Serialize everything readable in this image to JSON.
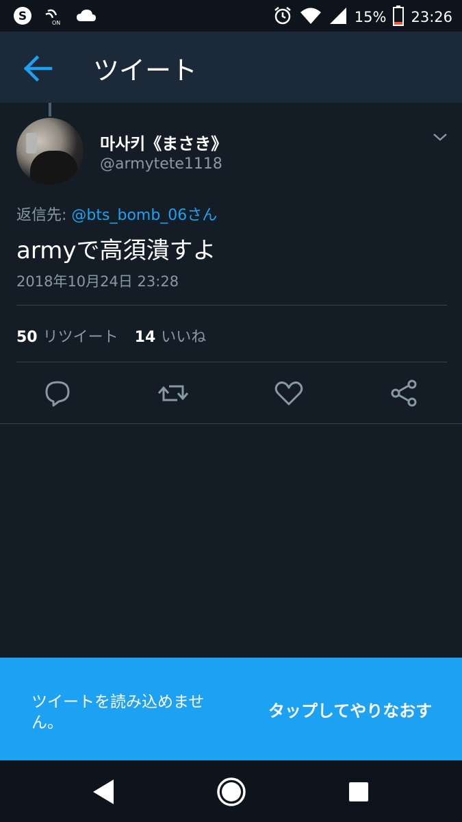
{
  "status_bar": {
    "battery_percent": "15%",
    "time": "23:26",
    "icons": [
      "skype-icon",
      "nfc-icon",
      "cloud-icon",
      "alarm-icon",
      "wifi-icon",
      "signal-icon",
      "battery-icon"
    ]
  },
  "app_bar": {
    "title": "ツイート",
    "back_icon": "arrow-left-icon"
  },
  "tweet": {
    "display_name": "마사키《まさき》",
    "handle": "@armytete1118",
    "reply_prefix": "返信先:",
    "reply_mention": "@bts_bomb_06さん",
    "text": "armyで高須潰すよ",
    "timestamp": "2018年10月24日 23:28",
    "retweet_count": "50",
    "retweet_label": "リツイート",
    "like_count": "14",
    "like_label": "いいね",
    "actions": [
      "reply-icon",
      "retweet-icon",
      "like-icon",
      "share-icon"
    ]
  },
  "snackbar": {
    "message": "ツイートを読み込めません。",
    "action": "タップしてやりなおす"
  },
  "colors": {
    "background": "#141d26",
    "app_bar": "#1c2938",
    "accent": "#1da1f2",
    "secondary_text": "#8899a6"
  }
}
